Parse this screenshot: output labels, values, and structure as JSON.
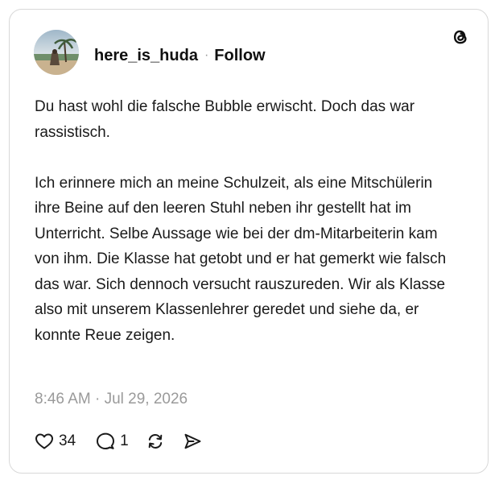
{
  "post": {
    "username": "here_is_huda",
    "separator": "·",
    "follow_label": "Follow",
    "paragraphs": [
      "Du hast wohl die falsche Bubble erwischt. Doch das war rassistisch.",
      "Ich erinnere mich an meine Schulzeit, als eine Mitschülerin ihre Beine auf den leeren Stuhl neben ihr gestellt hat im Unterricht. Selbe Aussage wie bei der dm-Mitarbeiterin kam von ihm. Die Klasse hat getobt und er hat gemerkt wie falsch das war. Sich dennoch versucht rauszureden. Wir als Klasse also mit unserem Klassenlehrer geredet und siehe da, er konnte Reue zeigen."
    ],
    "timestamp": "8:46 AM · Jul 29, 2026"
  },
  "actions": {
    "like_icon": "heart-icon",
    "like_count": "34",
    "reply_icon": "speech-bubble-icon",
    "reply_count": "1",
    "repost_icon": "repost-arrows-icon",
    "share_icon": "send-icon"
  },
  "brand": {
    "logo": "threads-logo-icon",
    "text_color": "#101010",
    "muted_color": "#9a9a9a",
    "border_color": "#d8d8d8"
  }
}
